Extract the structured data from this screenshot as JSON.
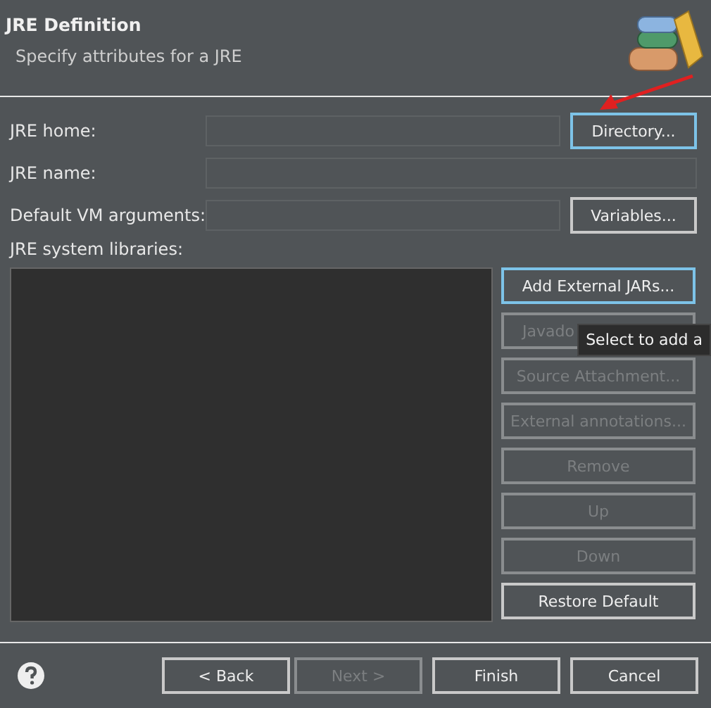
{
  "header": {
    "title": "JRE Definition",
    "subtitle": "Specify attributes for a JRE"
  },
  "fields": [
    {
      "label": "JRE home:",
      "button": {
        "label": "Directory...",
        "focused": true
      }
    },
    {
      "label": "JRE name:"
    },
    {
      "label": "Default VM arguments:",
      "button": {
        "label": "Variables...",
        "focused": false
      }
    }
  ],
  "libraries": {
    "label": "JRE system libraries:",
    "buttons": [
      {
        "label": "Add External JARs...",
        "disabled": false,
        "focused": true
      },
      {
        "label": "Javado",
        "disabled": true,
        "focused": false
      },
      {
        "label": "Source Attachment...",
        "disabled": true,
        "focused": false
      },
      {
        "label": "External annotations...",
        "disabled": true,
        "focused": false
      },
      {
        "label": "Remove",
        "disabled": true,
        "focused": false
      },
      {
        "label": "Up",
        "disabled": true,
        "focused": false
      },
      {
        "label": "Down",
        "disabled": true,
        "focused": false
      },
      {
        "label": "Restore Default",
        "disabled": false,
        "focused": false
      }
    ]
  },
  "tooltip": "Select to add a",
  "footer": {
    "buttons": [
      {
        "label": "< Back",
        "disabled": false
      },
      {
        "label": "Next >",
        "disabled": true
      },
      {
        "label": "Finish",
        "disabled": false
      },
      {
        "label": "Cancel",
        "disabled": false
      }
    ]
  }
}
